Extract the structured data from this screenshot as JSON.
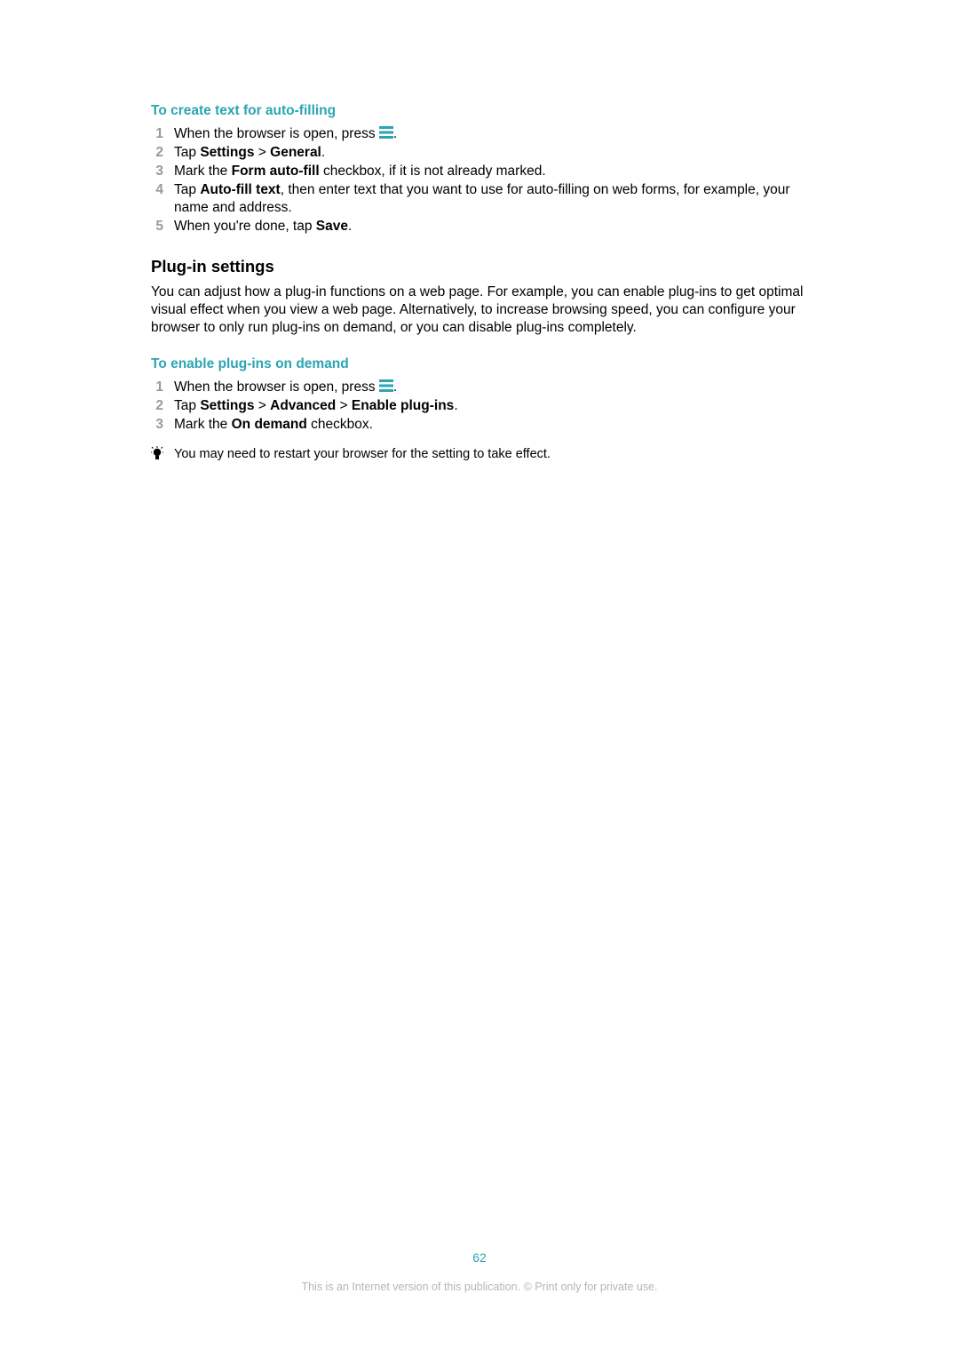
{
  "section1": {
    "title": "To create text for auto-filling",
    "steps": [
      {
        "num": "1",
        "text_a": "When the browser is open, press ",
        "text_b": "."
      },
      {
        "num": "2",
        "text_a": "Tap ",
        "b1": "Settings",
        "sep1": " > ",
        "b2": "General",
        "text_z": "."
      },
      {
        "num": "3",
        "text_a": "Mark the ",
        "b1": "Form auto-fill",
        "text_z": " checkbox, if it is not already marked."
      },
      {
        "num": "4",
        "text_a": "Tap ",
        "b1": "Auto-fill text",
        "text_z": ", then enter text that you want to use for auto-filling on web forms, for example, your name and address."
      },
      {
        "num": "5",
        "text_a": "When you're done, tap ",
        "b1": "Save",
        "text_z": "."
      }
    ]
  },
  "section2": {
    "heading": "Plug-in settings",
    "para": "You can adjust how a plug-in functions on a web page. For example, you can enable plug-ins to get optimal visual effect when you view a web page. Alternatively, to increase browsing speed, you can configure your browser to only run plug-ins on demand, or you can disable plug-ins completely."
  },
  "section3": {
    "title": "To enable plug-ins on demand",
    "steps": [
      {
        "num": "1",
        "text_a": "When the browser is open, press ",
        "text_b": "."
      },
      {
        "num": "2",
        "text_a": "Tap ",
        "b1": "Settings",
        "sep1": " > ",
        "b2": "Advanced",
        "sep2": " > ",
        "b3": "Enable plug-ins",
        "text_z": "."
      },
      {
        "num": "3",
        "text_a": "Mark the ",
        "b1": "On demand",
        "text_z": " checkbox."
      }
    ]
  },
  "tip": "You may need to restart your browser for the setting to take effect.",
  "page_number": "62",
  "disclaimer": "This is an Internet version of this publication. © Print only for private use."
}
